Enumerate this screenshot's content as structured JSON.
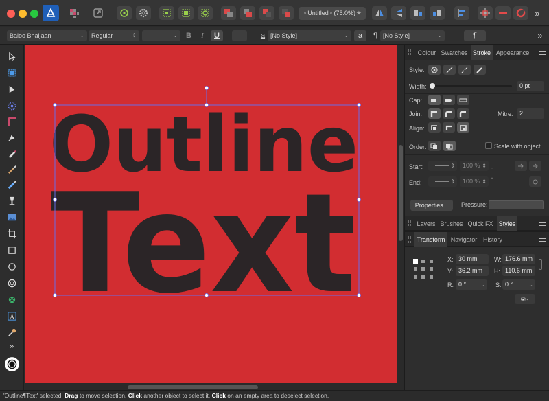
{
  "window": {
    "document_title": "<Untitled> (75.0%)",
    "modified_mark": "★"
  },
  "context_toolbar": {
    "font_family": "Baloo Bhaijaan",
    "font_style": "Regular",
    "font_size": "",
    "bold": "B",
    "italic": "I",
    "underline": "U",
    "char_style_icon": "a",
    "char_style": "[No Style]",
    "para_style_icon": "a",
    "para_mark": "¶",
    "para_style": "[No Style]",
    "para_button": "¶",
    "overflow": "»"
  },
  "tools": {
    "overflow": "»"
  },
  "canvas": {
    "background": "#d22d31",
    "text_color": "#2b2527",
    "line1": "Outline",
    "line2": "Text"
  },
  "stroke_panel": {
    "tabs": [
      "Colour",
      "Swatches",
      "Stroke",
      "Appearance"
    ],
    "active_tab": "Stroke",
    "style_label": "Style:",
    "width_label": "Width:",
    "width_value": "0 pt",
    "width_fraction": 0,
    "cap_label": "Cap:",
    "join_label": "Join:",
    "mitre_label": "Mitre:",
    "mitre_value": "2",
    "align_label": "Align:",
    "order_label": "Order:",
    "scale_label": "Scale with object",
    "start_label": "Start:",
    "start_scale": "100 %",
    "end_label": "End:",
    "end_scale": "100 %",
    "properties_button": "Properties...",
    "pressure_label": "Pressure:"
  },
  "layers_panel": {
    "tabs": [
      "Layers",
      "Brushes",
      "Quick FX",
      "Styles"
    ],
    "active_tab": "Styles"
  },
  "transform_panel": {
    "tabs": [
      "Transform",
      "Navigator",
      "History"
    ],
    "active_tab": "Transform",
    "x_label": "X:",
    "x_value": "30 mm",
    "y_label": "Y:",
    "y_value": "36.2 mm",
    "w_label": "W:",
    "w_value": "176.6 mm",
    "h_label": "H:",
    "h_value": "110.6 mm",
    "r_label": "R:",
    "r_value": "0 °",
    "s_label": "S:",
    "s_value": "0 °"
  },
  "status": {
    "text1": "'Outline¶Text' selected. ",
    "b1": "Drag",
    "text2": " to move selection. ",
    "b2": "Click",
    "text3": " another object to select it. ",
    "b3": "Click",
    "text4": " on an empty area to deselect selection."
  }
}
